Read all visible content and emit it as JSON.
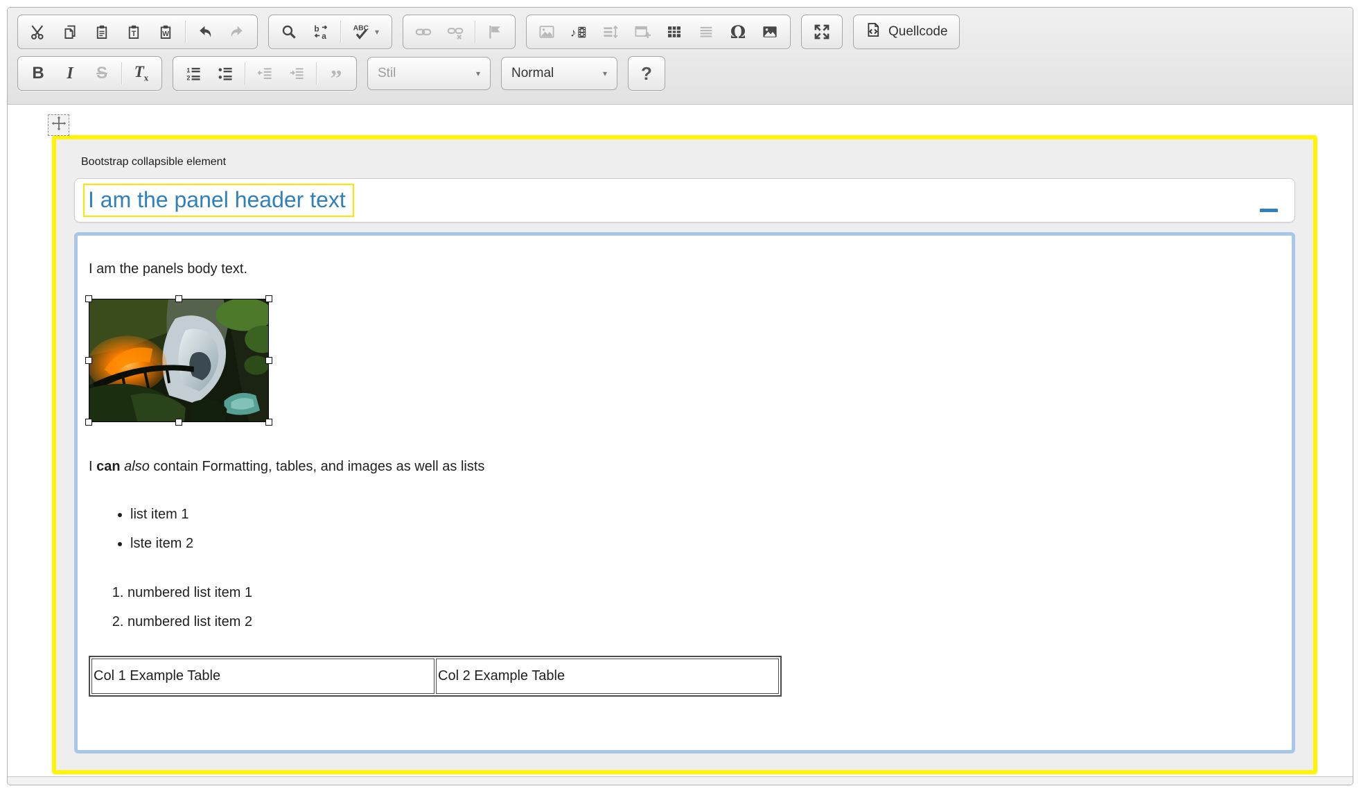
{
  "toolbar": {
    "quellcode_label": "Quellcode",
    "stil_placeholder": "Stil",
    "format_value": "Normal",
    "help_label": "?",
    "bold": "B",
    "italic": "I",
    "strike": "S",
    "removeformat_t": "T",
    "removeformat_x": "x",
    "spellcheck": "ABC",
    "replace_from": "b",
    "replace_to": "a",
    "omega": "Ω",
    "quote": "”",
    "ol_glyph_1": "1",
    "ol_glyph_2": "2",
    "paste_text_letter": "T",
    "paste_word_letter": "W",
    "media_note": "♪"
  },
  "icons": {
    "caret": "▾",
    "names": [
      "cut-icon",
      "copy-icon",
      "paste-icon",
      "paste-text-icon",
      "paste-word-icon",
      "undo-icon",
      "redo-icon",
      "search-icon",
      "replace-icon",
      "spellcheck-icon",
      "link-icon",
      "unlink-icon",
      "anchor-flag-icon",
      "image-icon",
      "media-icon",
      "line-spacing-icon",
      "iframe-icon",
      "table-icon",
      "horizontal-rule-icon",
      "special-char-icon",
      "enhanced-image-icon",
      "maximize-icon",
      "source-icon",
      "numbered-list-icon",
      "bulleted-list-icon",
      "outdent-icon",
      "indent-icon",
      "blockquote-icon",
      "move-handle-icon",
      "collapse-icon",
      "resize-handle-icon"
    ]
  },
  "widget": {
    "label": "Bootstrap collapsible element",
    "header_text": "I am the panel header text"
  },
  "body": {
    "paragraph1": "I am the panels body text.",
    "formatted": {
      "seg1": "I ",
      "bold": "can",
      "sep": " ",
      "italic": "also",
      "rest": " contain Formatting, tables, and images as well as lists"
    },
    "bullet_items": [
      "list item 1",
      "lste item 2"
    ],
    "numbered_items": [
      "numbered list item 1",
      "numbered list item 2"
    ],
    "table": {
      "cells": [
        "Col 1 Example Table",
        "Col 2 Example Table"
      ]
    }
  },
  "colors": {
    "widget_outline_yellow": "#fff500",
    "nested_editable_yellow": "#ffe400",
    "header_text_blue": "#2f80bd",
    "panel_border_blue": "#a8c6e8",
    "toolbar_icon": "#474747",
    "toolbar_icon_disabled": "#b9b9b9"
  }
}
